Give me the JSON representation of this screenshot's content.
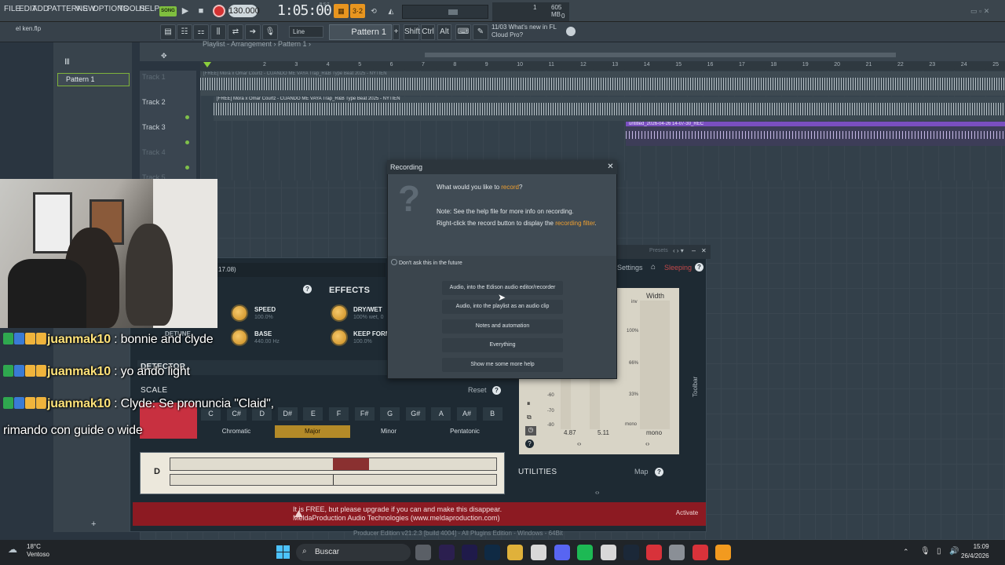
{
  "menu": [
    "FILE",
    "EDIT",
    "ADD",
    "PATTERNS",
    "VIEW",
    "OPTIONS",
    "TOOLS",
    "HELP"
  ],
  "transport": {
    "song_label": "SONG",
    "tempo": "130.000",
    "time": "1:05:00",
    "time_sub": "B:S:T"
  },
  "cpu": {
    "voices": "1",
    "ram": "605 MB",
    "peak": "0"
  },
  "toolbar2": {
    "file": "el ken.flp",
    "snap": "Line",
    "pattern": "Pattern 1",
    "shift": "Shift",
    "ctrl": "Ctrl",
    "alt": "Alt",
    "news_date": "11/03",
    "news_line1": "What's new in FL",
    "news_line2": "Cloud Pro?"
  },
  "playlist": {
    "title": "Playlist - Arrangement › Pattern 1 ›",
    "pattern_item": "Pattern 1",
    "ruler": [
      "2",
      "3",
      "4",
      "5",
      "6",
      "7",
      "8",
      "9",
      "10",
      "11",
      "12",
      "13",
      "14",
      "15",
      "16",
      "17",
      "18",
      "19",
      "20",
      "21",
      "22",
      "23",
      "24",
      "25"
    ],
    "tracks": [
      "Track 1",
      "Track 2",
      "Track 3",
      "Track 4",
      "Track 5"
    ],
    "clip1": "[FREE] Mora x Omar Courtz - CUANDO ME VAYA  Trap_R&B Type Beat 2025 - NYTIEN",
    "clip2": "[FREE] Mora x Omar Courtz - CUANDO ME VAYA  Trap_R&B Type Beat 2025 - NYTIEN",
    "clip3": "untitled_2026-04-26 14-07-30_REC"
  },
  "plugin": {
    "title_value": "17.08)",
    "effects": "EFFECTS",
    "speed_label": "SPEED",
    "speed_val": "100.0%",
    "base_label": "BASE",
    "base_val": "440.00 Hz",
    "detune": "DETUNE",
    "drywet_label": "DRY/WET",
    "drywet_val": "100% wet, 0",
    "keep_label": "KEEP FORM",
    "keep_val": "100.0%",
    "detector": "DETECTOR",
    "scale": "SCALE",
    "reset": "Reset",
    "notes": [
      "C",
      "C#",
      "D",
      "D#",
      "E",
      "F",
      "F#",
      "G",
      "G#",
      "A",
      "A#",
      "B"
    ],
    "scales": [
      "Chromatic",
      "Major",
      "Minor",
      "Pentatonic"
    ],
    "selected_scale": "Major",
    "key_letter": "D",
    "presets": "Presets",
    "settings": "Settings",
    "sleeping": "Sleeping",
    "width": "Width",
    "meter_ticks": [
      "inv",
      "100%",
      "66%",
      "33%",
      "mono"
    ],
    "db_ticks": [
      "-60",
      "-70",
      "-80"
    ],
    "meter_vals": [
      "4.87",
      "5.11"
    ],
    "meter_mono": "mono",
    "toolbar_label": "Toolbar",
    "utilities": "UTILITIES",
    "map": "Map",
    "promo1": "It is FREE, but please upgrade if you can and make this disappear.",
    "promo2": "MeldaProduction Audio Technologies (www.meldaproduction.com)",
    "activate": "Activate"
  },
  "dialog": {
    "title": "Recording",
    "q_pre": "What would you like to ",
    "q_hl": "record",
    "q_post": "?",
    "note1": "Note: See the help file for more info on recording.",
    "note2_pre": "Right-click the record button to display the ",
    "note2_hl": "recording filter",
    "note2_post": ".",
    "checkbox": "Don't ask this in the future",
    "options": [
      "Audio, into the Edison audio editor/recorder",
      "Audio, into the playlist as an audio clip",
      "Notes and automation",
      "Everything",
      "Show me some more help"
    ]
  },
  "chat": [
    {
      "user": "juanmak10",
      "msg": " : bonnie and clyde"
    },
    {
      "user": "juanmak10",
      "msg": " : yo ando light"
    },
    {
      "user": "juanmak10",
      "msg": " : Clyde: Se pronuncia \"Claid\","
    },
    {
      "user": "",
      "msg": "rimando con guide o wide"
    }
  ],
  "status_text": "Producer Edition v21.2.3 [build 4004] - All Plugins Edition - Windows - 64Bit",
  "taskbar": {
    "temp": "18°C",
    "weather": "Ventoso",
    "search": "Buscar",
    "time": "15:09",
    "date": "26/4/2026"
  },
  "colors": {
    "accent": "#e8951f",
    "record": "#d43232",
    "clip_rec": "#7a4fc0",
    "promo": "#8c1a22"
  }
}
